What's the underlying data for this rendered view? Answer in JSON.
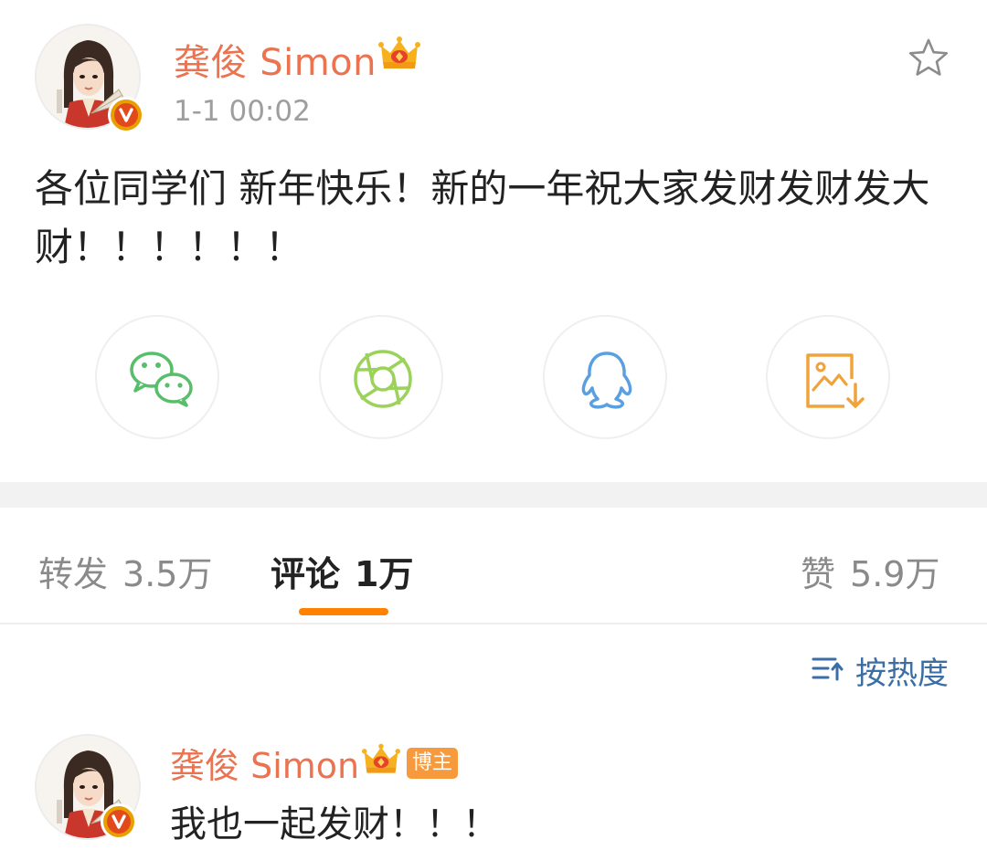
{
  "post": {
    "author_name": "龚俊 Simon",
    "time": "1-1 00:02",
    "text": "各位同学们 新年快乐！新的一年祝大家发财发财发大财！！！！！！",
    "favorite_icon": "star-outline-icon",
    "verified_icon": "verified-v-icon",
    "crown_icon": "crown-icon"
  },
  "share": {
    "buttons": [
      {
        "icon": "wechat-icon",
        "color": "#57be6a"
      },
      {
        "icon": "moments-icon",
        "color": "#9bd25a"
      },
      {
        "icon": "qq-icon",
        "color": "#5aa0e0"
      },
      {
        "icon": "save-image-icon",
        "color": "#f0a33a"
      }
    ]
  },
  "tabs": {
    "repost_label": "转发",
    "repost_count": "3.5万",
    "comments_label": "评论",
    "comments_count": "1万",
    "likes_label": "赞",
    "likes_count": "5.9万",
    "active_color": "#ff8200"
  },
  "sort": {
    "label": "按热度",
    "icon": "sort-icon"
  },
  "comment": {
    "author_name": "龚俊 Simon",
    "owner_badge": "博主",
    "text": "我也一起发财！！！"
  },
  "colors": {
    "name": "#eb7350",
    "link": "#3b6ea5",
    "accent": "#ff8200",
    "badge": "#f79a3e"
  }
}
